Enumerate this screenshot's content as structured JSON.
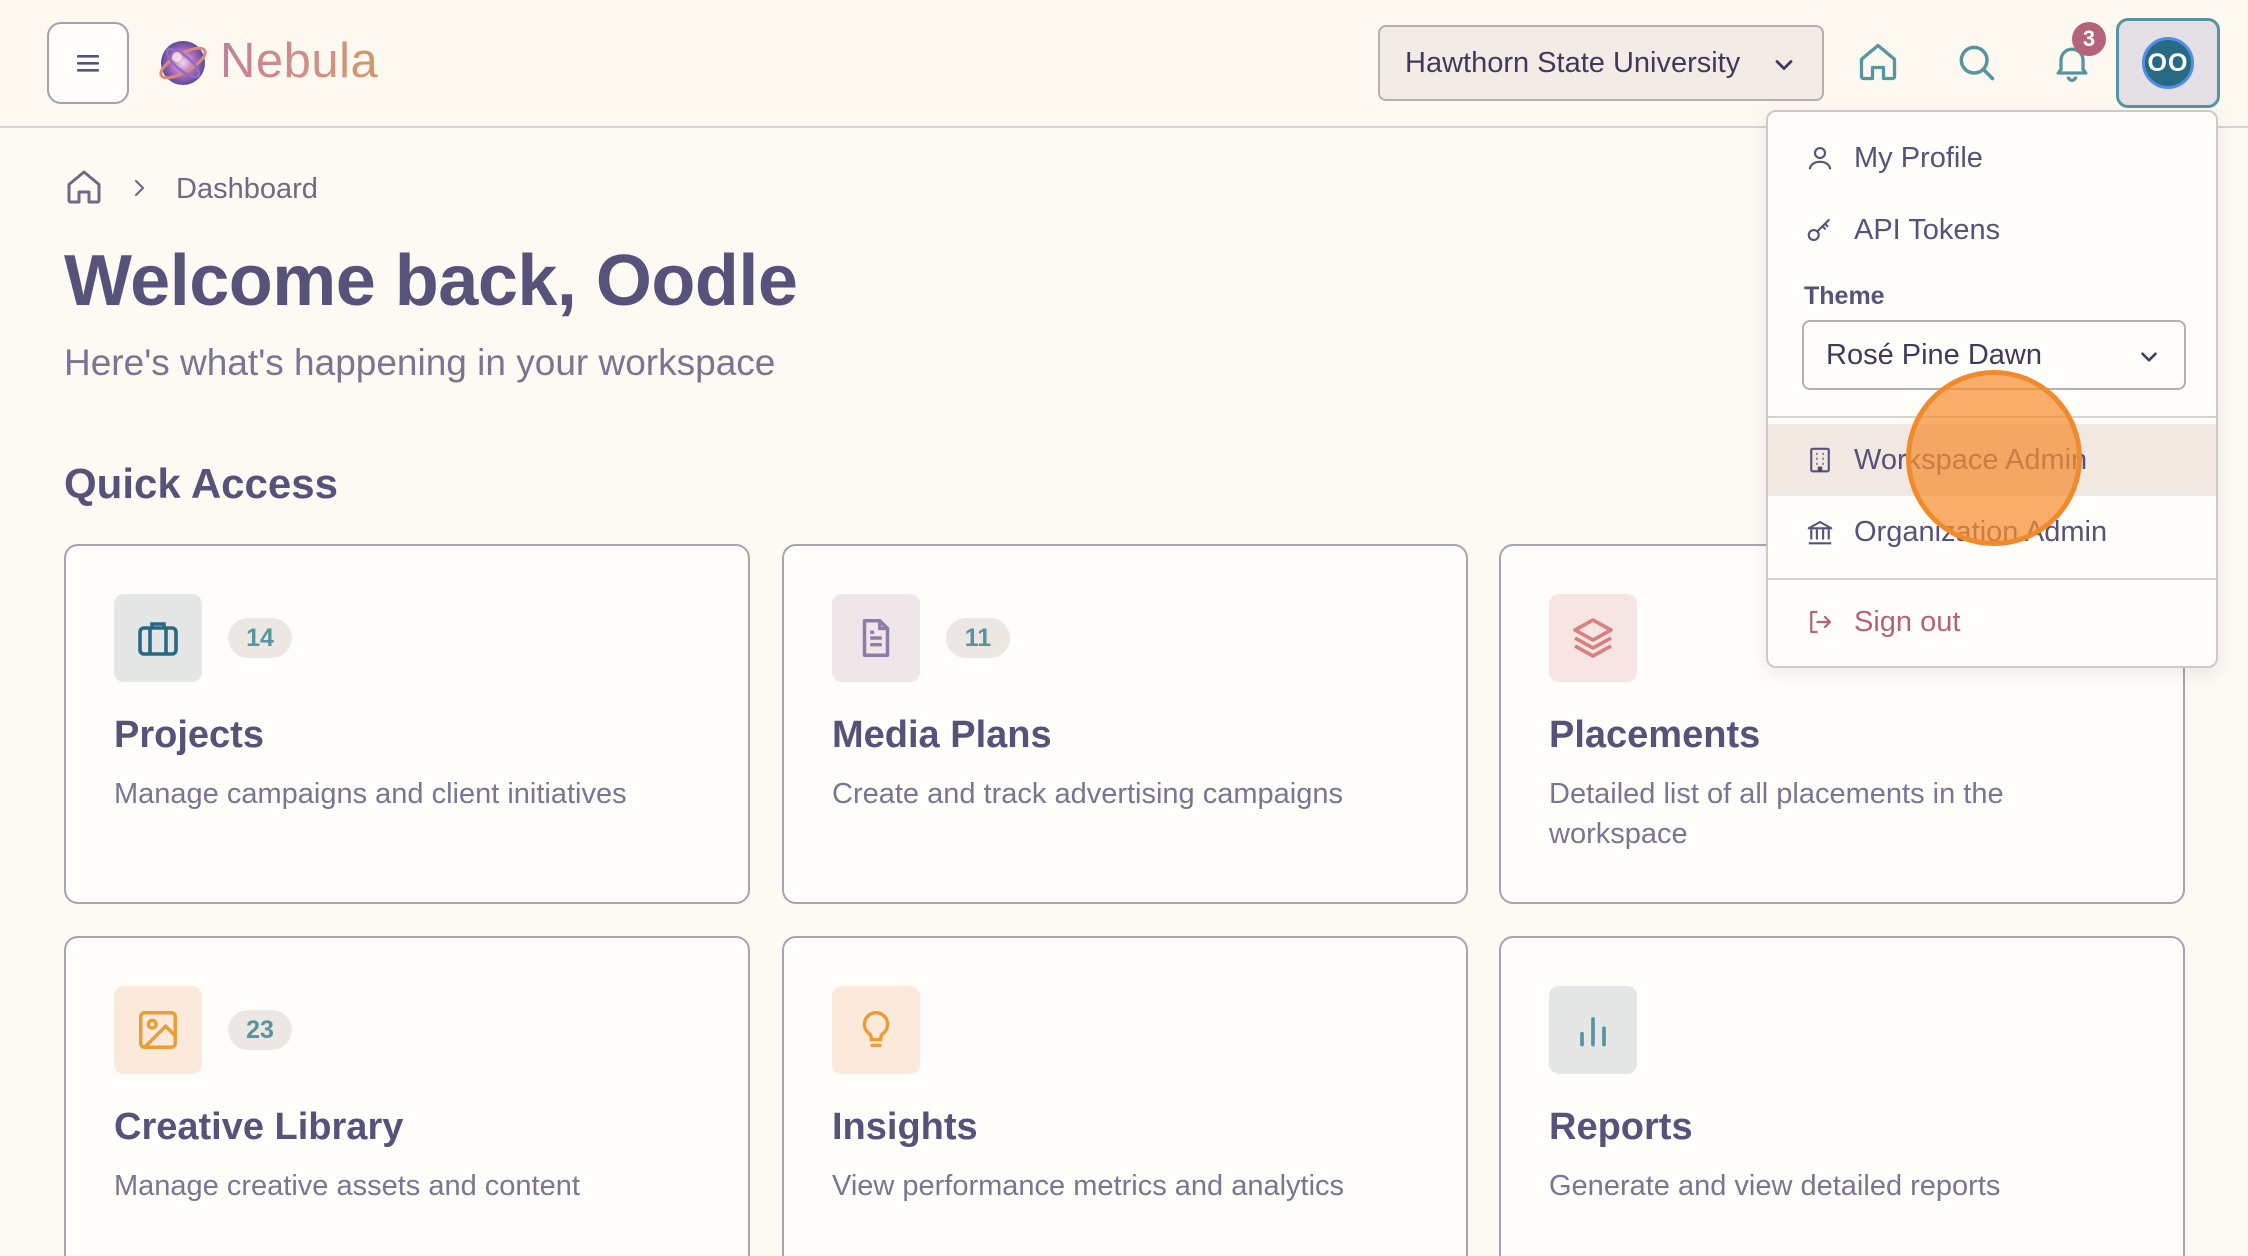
{
  "header": {
    "app_name": "Nebula",
    "organization": "Hawthorn State University",
    "notifications_count": "3",
    "avatar_initials": "OO"
  },
  "breadcrumb": {
    "current": "Dashboard"
  },
  "page": {
    "title": "Welcome back, Oodle",
    "subtitle": "Here's what's happening in your workspace",
    "section_title": "Quick Access"
  },
  "cards": [
    {
      "title": "Projects",
      "description": "Manage campaigns and client initiatives",
      "count": "14",
      "icon": "briefcase-icon"
    },
    {
      "title": "Media Plans",
      "description": "Create and track advertising campaigns",
      "count": "11",
      "icon": "document-icon"
    },
    {
      "title": "Placements",
      "description": "Detailed list of all placements in the workspace",
      "icon": "layers-icon"
    },
    {
      "title": "Creative Library",
      "description": "Manage creative assets and content",
      "count": "23",
      "icon": "image-icon"
    },
    {
      "title": "Insights",
      "description": "View performance metrics and analytics",
      "icon": "lightbulb-icon"
    },
    {
      "title": "Reports",
      "description": "Generate and view detailed reports",
      "icon": "bar-chart-icon"
    }
  ],
  "user_menu": {
    "my_profile": "My Profile",
    "api_tokens": "API Tokens",
    "theme_label": "Theme",
    "theme_value": "Rosé Pine Dawn",
    "workspace_admin": "Workspace Admin",
    "organization_admin": "Organization Admin",
    "sign_out": "Sign out"
  },
  "colors": {
    "background": "#fdf9f3",
    "text": "#575279",
    "accent_teal": "#56949f",
    "accent_rose": "#b4637a",
    "accent_gold": "#ea9d34",
    "accent_iris": "#907aa9"
  }
}
